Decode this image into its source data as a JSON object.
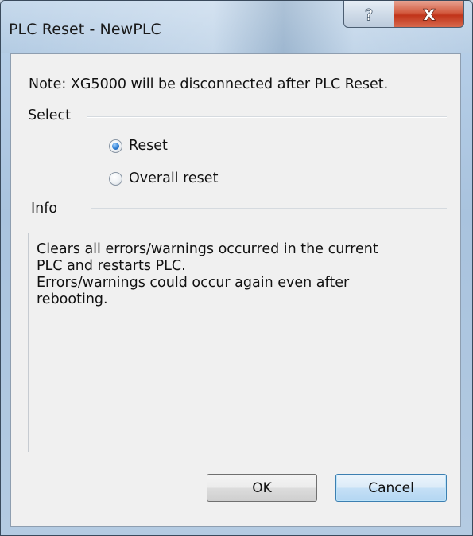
{
  "window": {
    "title": "PLC Reset - NewPLC",
    "help_glyph": "?",
    "close_glyph": "X"
  },
  "note": "Note: XG5000 will be disconnected after PLC Reset.",
  "select_group": {
    "label": "Select",
    "options": [
      {
        "label": "Reset",
        "checked": true
      },
      {
        "label": "Overall reset",
        "checked": false
      }
    ]
  },
  "info_group": {
    "label": "Info",
    "text": "Clears all errors/warnings occurred in the current\nPLC and restarts PLC.\nErrors/warnings could occur again even after\nrebooting."
  },
  "buttons": {
    "ok": "OK",
    "cancel": "Cancel"
  },
  "colors": {
    "titlebar": "#b9d1ea",
    "close_button": "#c7432a",
    "dialog_background": "#f0f0f0",
    "default_button_border": "#3c7fb1"
  }
}
